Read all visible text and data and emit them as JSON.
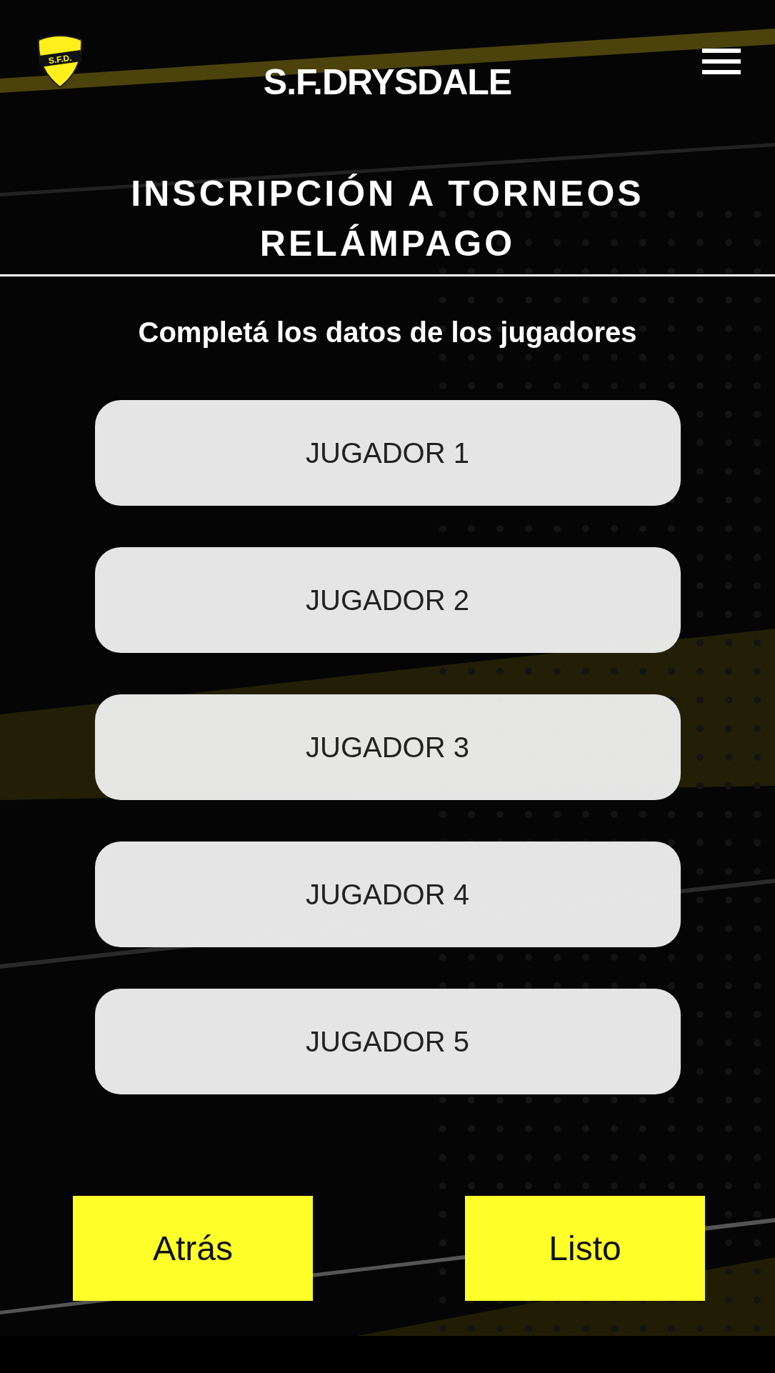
{
  "header": {
    "brand": "S.F.DRYSDALE",
    "logo_text": "S.F.D."
  },
  "page_title": "INSCRIPCIÓN A TORNEOS RELÁMPAGO",
  "subtitle": "Completá los datos de los jugadores",
  "players": [
    {
      "label": "JUGADOR 1"
    },
    {
      "label": "JUGADOR 2"
    },
    {
      "label": "JUGADOR 3"
    },
    {
      "label": "JUGADOR 4"
    },
    {
      "label": "JUGADOR 5"
    }
  ],
  "buttons": [
    {
      "label": "Atrás"
    },
    {
      "label": "Listo"
    }
  ]
}
